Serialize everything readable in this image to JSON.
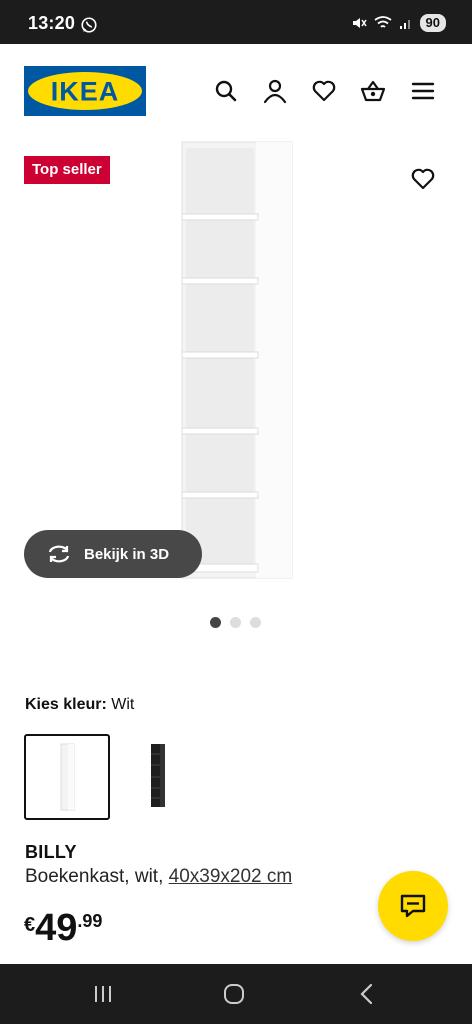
{
  "status_bar": {
    "time": "13:20",
    "battery": "90",
    "icons": [
      "whatsapp-icon",
      "mute-icon",
      "wifi-icon",
      "signal-icon"
    ]
  },
  "header": {
    "logo_text": "IKEA",
    "brand_colors": {
      "blue": "#0058a3",
      "yellow": "#ffdb00"
    },
    "icons": [
      "search-icon",
      "account-icon",
      "wishlist-icon",
      "cart-icon",
      "menu-icon"
    ]
  },
  "gallery": {
    "badge": "Top seller",
    "badge_color": "#cc0033",
    "view_3d_label": "Bekijk in 3D",
    "image_count": 3,
    "active_image": 1
  },
  "color_select": {
    "label": "Kies kleur:",
    "value": "Wit",
    "options": [
      "white",
      "black"
    ],
    "selected": "white"
  },
  "product": {
    "name": "BILLY",
    "description": "Boekenkast, wit, ",
    "dimensions": "40x39x202 cm",
    "price_currency": "€",
    "price_integer": "49",
    "price_decimals": ".99"
  },
  "chat": {
    "icon": "chat-icon",
    "color": "#ffdb00"
  },
  "nav": {
    "icons": [
      "recent-apps-icon",
      "home-icon",
      "back-icon"
    ]
  }
}
